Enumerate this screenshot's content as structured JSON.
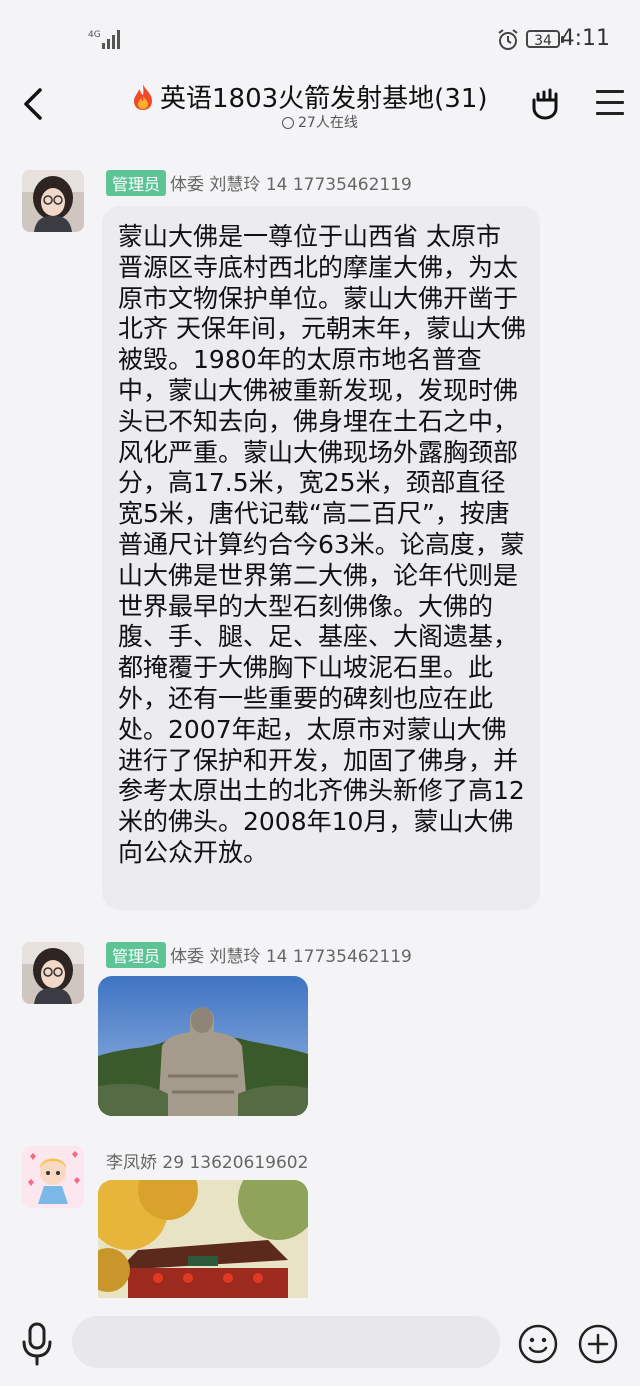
{
  "status_bar": {
    "network": "4G",
    "battery": "34",
    "time": "4:11"
  },
  "header": {
    "title": "英语1803火箭发射基地(31)",
    "online": "27人在线"
  },
  "messages": [
    {
      "role": "管理员",
      "sender": "体委 刘慧玲 14  17735462119",
      "text": "蒙山大佛是一尊位于山西省 太原市 晋源区寺底村西北的摩崖大佛，为太原市文物保护单位。蒙山大佛开凿于 北齐 天保年间，元朝末年，蒙山大佛被毁。1980年的太原市地名普查中，蒙山大佛被重新发现，发现时佛头已不知去向，佛身埋在土石之中，风化严重。蒙山大佛现场外露胸颈部分，高17.5米，宽25米，颈部直径宽5米，唐代记载“高二百尺”，按唐普通尺计算约合今63米。论高度，蒙山大佛是世界第二大佛，论年代则是世界最早的大型石刻佛像。大佛的腹、手、腿、足、基座、大阁遗基，都掩覆于大佛胸下山坡泥石里。此外，还有一些重要的碑刻也应在此处。2007年起，太原市对蒙山大佛进行了保护和开发，加固了佛身，并参考太原出土的北齐佛头新修了高12米的佛头。2008年10月，蒙山大佛向公众开放。"
    },
    {
      "role": "管理员",
      "sender": "体委 刘慧玲 14  17735462119"
    },
    {
      "sender": "李凤娇 29 13620619602"
    }
  ],
  "input": {
    "placeholder": ""
  }
}
